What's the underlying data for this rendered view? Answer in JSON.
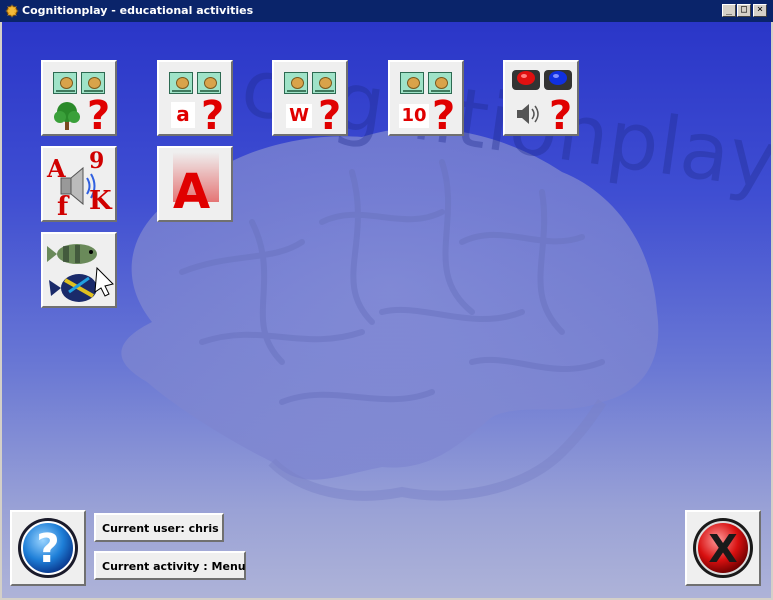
{
  "window": {
    "title": "Cognitionplay - educational activities",
    "minimize": "_",
    "maximize": "□",
    "close": "×"
  },
  "watermark": "cognitionplay",
  "activities": {
    "row1": [
      {
        "id": "picture-match",
        "icon": "tree-icon"
      },
      {
        "id": "lowercase-letter-match",
        "letter": "a"
      },
      {
        "id": "uppercase-letter-match",
        "letter": "W"
      },
      {
        "id": "number-match",
        "letter": "10"
      },
      {
        "id": "sound-match",
        "icon": "speaker-icon"
      }
    ],
    "row2": [
      {
        "id": "letters-sound",
        "letters": [
          "A",
          "9",
          "f",
          "K"
        ]
      },
      {
        "id": "letter-fade",
        "letter": "A"
      }
    ],
    "row3": [
      {
        "id": "fish-click",
        "icon": "fish-icon"
      }
    ],
    "question_mark": "?"
  },
  "footer": {
    "current_user": "Current user: chris",
    "current_activity": "Current activity : Menu",
    "help_symbol": "?",
    "exit_symbol": "X"
  },
  "colors": {
    "title_bar": "#0a246a",
    "accent_red": "#e00000",
    "help_blue": "#1e7fd8",
    "exit_red": "#d81010"
  }
}
